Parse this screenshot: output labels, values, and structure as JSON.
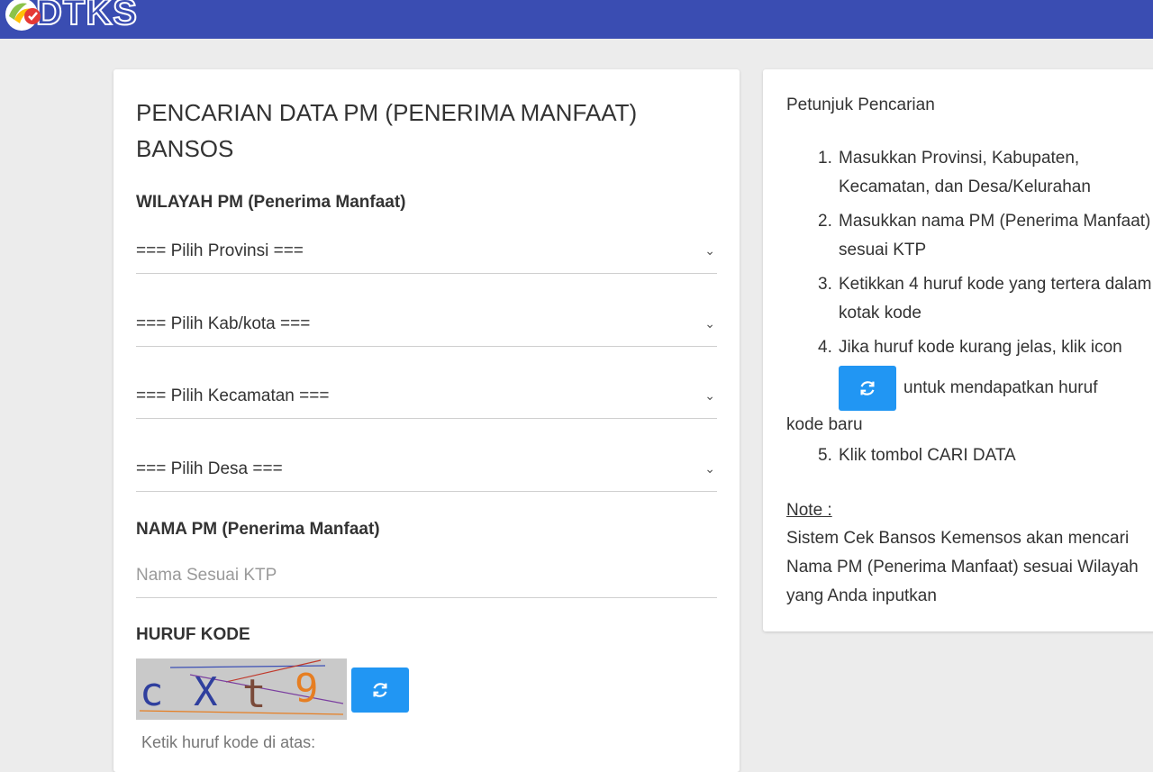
{
  "header": {
    "logo_text": "DTKS",
    "bar_color": "#3a4db2"
  },
  "form": {
    "title": "PENCARIAN DATA PM (PENERIMA MANFAAT) BANSOS",
    "wilayah_label": "WILAYAH PM (Penerima Manfaat)",
    "selects": [
      {
        "name": "provinsi",
        "value": "=== Pilih Provinsi ==="
      },
      {
        "name": "kabkota",
        "value": "=== Pilih Kab/kota ==="
      },
      {
        "name": "kecamatan",
        "value": "=== Pilih Kecamatan ==="
      },
      {
        "name": "desa",
        "value": "=== Pilih Desa ==="
      }
    ],
    "nama_label": "NAMA PM (Penerima Manfaat)",
    "nama_placeholder": "Nama Sesuai KTP",
    "kode_label": "HURUF KODE",
    "captcha_chars": [
      "c",
      "X",
      "t",
      "9"
    ],
    "kode_hint": "Ketik huruf kode di atas:",
    "refresh_icon": "refresh-icon",
    "accent_color": "#2196f3"
  },
  "guide": {
    "title": "Petunjuk Pencarian",
    "steps": [
      {
        "num": "1.",
        "text": "Masukkan Provinsi, Kabupaten, Kecamatan, dan Desa/Kelurahan"
      },
      {
        "num": "2.",
        "text": "Masukkan nama PM (Penerima Manfaat) sesuai KTP"
      },
      {
        "num": "3.",
        "text": "Ketikkan 4 huruf kode yang tertera dalam kotak kode"
      },
      {
        "num": "4.",
        "text_before": "Jika huruf kode kurang jelas, klik icon",
        "text_after": "untuk mendapatkan huruf",
        "text_end": "kode baru"
      },
      {
        "num": "5.",
        "text": "Klik tombol CARI DATA"
      }
    ],
    "note_label": "Note :",
    "note_text": "Sistem Cek Bansos Kemensos akan mencari Nama PM (Penerima Manfaat) sesuai Wilayah yang Anda inputkan"
  }
}
